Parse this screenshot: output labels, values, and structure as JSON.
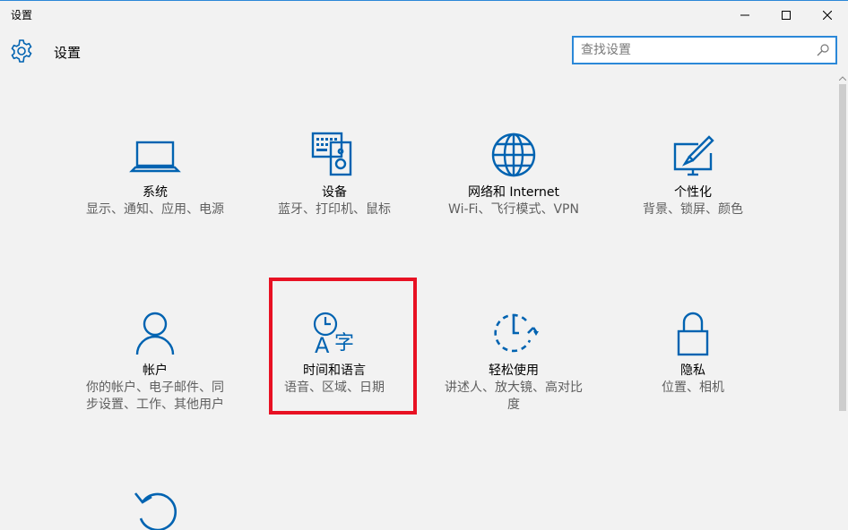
{
  "window": {
    "title": "设置",
    "accent": "#0063b1",
    "highlight_color": "#e81123"
  },
  "header": {
    "title": "设置",
    "search_placeholder": "查找设置"
  },
  "tiles": [
    {
      "name": "系统",
      "desc": "显示、通知、应用、电源",
      "icon": "laptop-icon"
    },
    {
      "name": "设备",
      "desc": "蓝牙、打印机、鼠标",
      "icon": "keyboard-speaker-icon"
    },
    {
      "name": "网络和 Internet",
      "desc": "Wi-Fi、飞行模式、VPN",
      "icon": "globe-icon"
    },
    {
      "name": "个性化",
      "desc": "背景、锁屏、颜色",
      "icon": "paint-monitor-icon"
    },
    {
      "name": "帐户",
      "desc": "你的帐户、电子邮件、同步设置、工作、其他用户",
      "icon": "person-icon"
    },
    {
      "name": "时间和语言",
      "desc": "语音、区域、日期",
      "icon": "time-language-icon"
    },
    {
      "name": "轻松使用",
      "desc": "讲述人、放大镜、高对比度",
      "icon": "ease-of-access-icon"
    },
    {
      "name": "隐私",
      "desc": "位置、相机",
      "icon": "lock-icon"
    },
    {
      "name": "",
      "desc": "",
      "icon": "update-icon"
    }
  ]
}
